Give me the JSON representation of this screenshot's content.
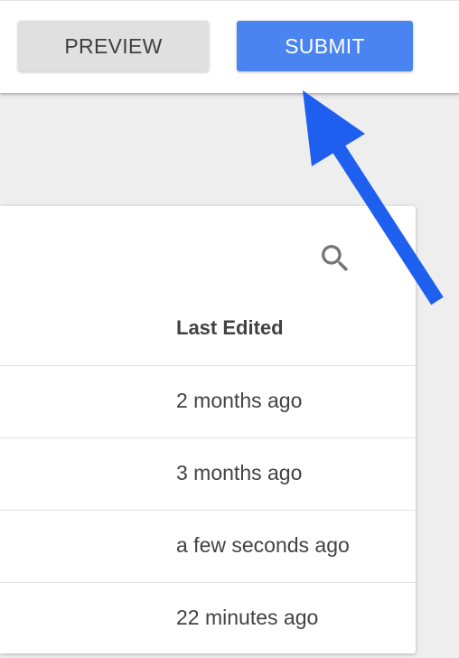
{
  "toolbar": {
    "preview_label": "PREVIEW",
    "submit_label": "SUBMIT"
  },
  "table": {
    "search_icon": "search-icon",
    "column_header": "Last Edited",
    "rows": [
      {
        "last_edited": "2 months ago"
      },
      {
        "last_edited": "3 months ago"
      },
      {
        "last_edited": "a few seconds ago"
      },
      {
        "last_edited": "22 minutes ago"
      }
    ]
  },
  "colors": {
    "submit_button": "#4a84f0",
    "preview_button": "#e0e0e0",
    "annotation_arrow": "#1f5ff0",
    "background": "#eeeeee"
  }
}
